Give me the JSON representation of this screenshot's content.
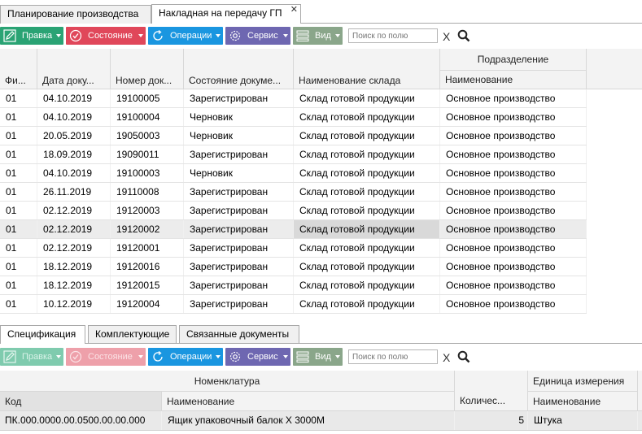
{
  "tabs": [
    {
      "label": "Планирование производства"
    },
    {
      "label": "Накладная на передачу ГП",
      "close": "✕"
    }
  ],
  "toolbar": {
    "edit": "Правка",
    "state": "Состояние",
    "ops": "Операции",
    "service": "Сервис",
    "view": "Вид",
    "search_placeholder": "Поиск по полю",
    "clear": "X"
  },
  "main_grid": {
    "group_header": "Подразделение",
    "columns": [
      "Фи...",
      "Дата доку...",
      "Номер док...",
      "Состояние докуме...",
      "Наименование склада",
      "Наименование"
    ],
    "rows": [
      [
        "01",
        "04.10.2019",
        "19100005",
        "Зарегистрирован",
        "Склад готовой продукции",
        "Основное производство"
      ],
      [
        "01",
        "04.10.2019",
        "19100004",
        "Черновик",
        "Склад готовой продукции",
        "Основное производство"
      ],
      [
        "01",
        "20.05.2019",
        "19050003",
        "Черновик",
        "Склад готовой продукции",
        "Основное производство"
      ],
      [
        "01",
        "18.09.2019",
        "19090011",
        "Зарегистрирован",
        "Склад готовой продукции",
        "Основное производство"
      ],
      [
        "01",
        "04.10.2019",
        "19100003",
        "Черновик",
        "Склад готовой продукции",
        "Основное производство"
      ],
      [
        "01",
        "26.11.2019",
        "19110008",
        "Зарегистрирован",
        "Склад готовой продукции",
        "Основное производство"
      ],
      [
        "01",
        "02.12.2019",
        "19120003",
        "Зарегистрирован",
        "Склад готовой продукции",
        "Основное производство"
      ],
      [
        "01",
        "02.12.2019",
        "19120002",
        "Зарегистрирован",
        "Склад готовой продукции",
        "Основное производство"
      ],
      [
        "01",
        "02.12.2019",
        "19120001",
        "Зарегистрирован",
        "Склад готовой продукции",
        "Основное производство"
      ],
      [
        "01",
        "18.12.2019",
        "19120016",
        "Зарегистрирован",
        "Склад готовой продукции",
        "Основное производство"
      ],
      [
        "01",
        "18.12.2019",
        "19120015",
        "Зарегистрирован",
        "Склад готовой продукции",
        "Основное производство"
      ],
      [
        "01",
        "10.12.2019",
        "19120004",
        "Зарегистрирован",
        "Склад готовой продукции",
        "Основное производство"
      ]
    ],
    "selected_row": 7
  },
  "detail_tabs": [
    {
      "label": "Спецификация"
    },
    {
      "label": "Комплектующие"
    },
    {
      "label": "Связанные документы"
    }
  ],
  "detail_grid": {
    "group_nomen": "Номенклатура",
    "group_unit": "Единица измерения",
    "columns": [
      "Код",
      "Наименование",
      "Количес...",
      "Наименование"
    ],
    "rows": [
      [
        "ПК.000.0000.00.0500.00.00.000",
        "Ящик упаковочный балок Х 3000М",
        "5",
        "Штука"
      ]
    ]
  },
  "colors": {
    "edit": "#2aa374",
    "state": "#e0475a",
    "ops": "#1a96e0",
    "service": "#6e67b1",
    "view": "#8aa68a"
  }
}
